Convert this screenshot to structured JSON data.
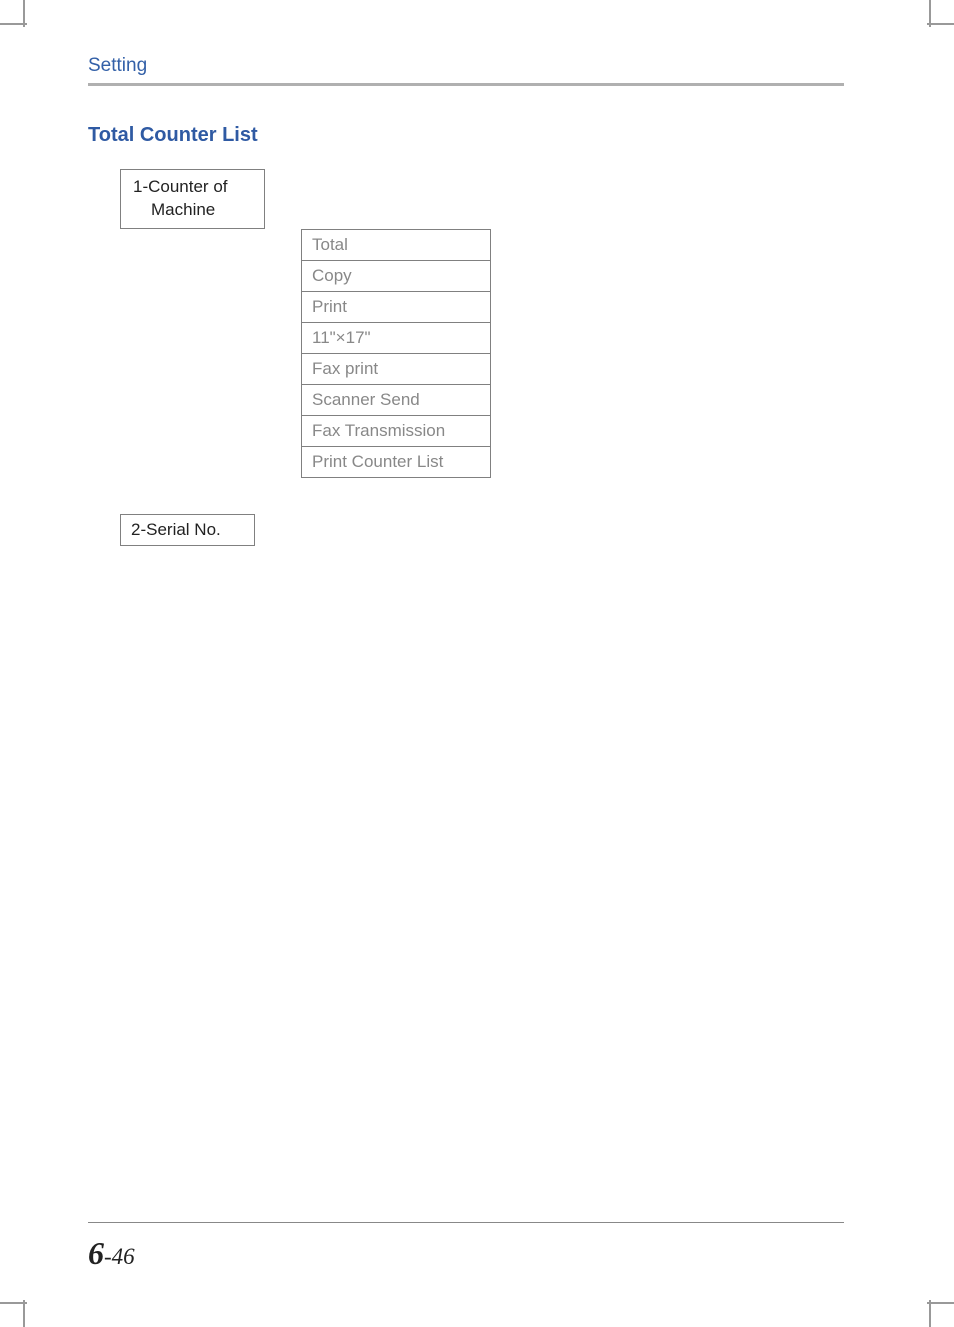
{
  "header": {
    "title": "Setting"
  },
  "section": {
    "heading": "Total Counter List"
  },
  "tree": {
    "mainBox": {
      "line1": "1-Counter of",
      "line2": "Machine"
    },
    "items": [
      "Total",
      "Copy",
      "Print",
      "11\"×17\"",
      "Fax print",
      "Scanner Send",
      "Fax Transmission",
      "Print Counter List"
    ],
    "secondaryBox": "2-Serial No."
  },
  "footer": {
    "chapter": "6",
    "dash": "-",
    "page": "46"
  }
}
